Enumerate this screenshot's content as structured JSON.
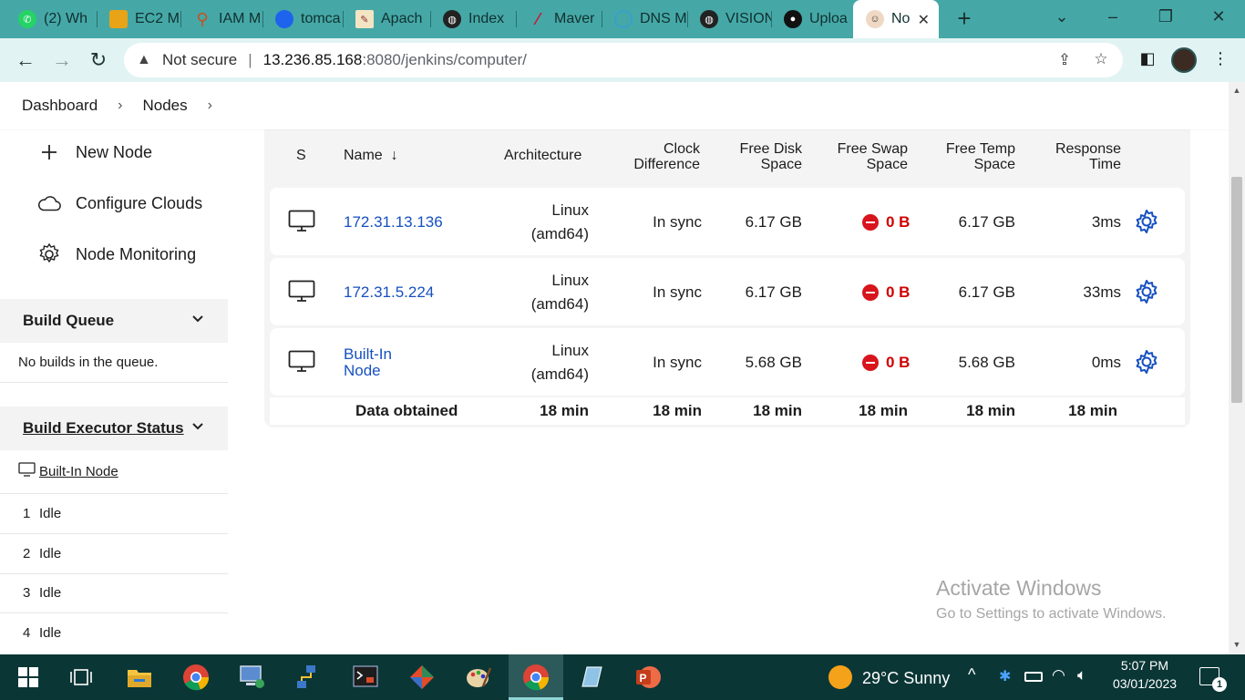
{
  "browser": {
    "tabs": [
      {
        "title": "(2) Wh",
        "icon": "whatsapp-icon",
        "color": "#25d366"
      },
      {
        "title": "EC2 M",
        "icon": "aws-ec2-icon",
        "color": "#e8a317"
      },
      {
        "title": "IAM M",
        "icon": "aws-iam-icon",
        "color": "#c7511f"
      },
      {
        "title": "tomca",
        "icon": "docker-icon",
        "color": "#1d63ed"
      },
      {
        "title": "Apach",
        "icon": "apache-icon",
        "color": "#8a2b2b"
      },
      {
        "title": "Index",
        "icon": "globe-icon",
        "color": "#222222"
      },
      {
        "title": "Maver",
        "icon": "maven-icon",
        "color": "#c71a36"
      },
      {
        "title": "DNS M",
        "icon": "dns-icon",
        "color": "#3aa0c8"
      },
      {
        "title": "VISION",
        "icon": "globe-icon",
        "color": "#222222"
      },
      {
        "title": "Uploa",
        "icon": "github-icon",
        "color": "#111111"
      },
      {
        "title": "No",
        "icon": "jenkins-icon",
        "color": "#d33833"
      }
    ],
    "url_host": "13.236.85.168",
    "url_rest": ":8080/jenkins/computer/",
    "security_label": "Not secure"
  },
  "breadcrumb": {
    "items": [
      "Dashboard",
      "Nodes"
    ]
  },
  "sidebar": {
    "tasks": [
      {
        "label": "New Node",
        "icon": "plus-icon"
      },
      {
        "label": "Configure Clouds",
        "icon": "cloud-icon"
      },
      {
        "label": "Node Monitoring",
        "icon": "gear-icon"
      }
    ],
    "build_queue": {
      "title": "Build Queue",
      "empty_text": "No builds in the queue."
    },
    "executor_status": {
      "title": "Build Executor Status",
      "node": "Built-In Node",
      "executors": [
        {
          "num": "1",
          "state": "Idle"
        },
        {
          "num": "2",
          "state": "Idle"
        },
        {
          "num": "3",
          "state": "Idle"
        },
        {
          "num": "4",
          "state": "Idle"
        }
      ]
    }
  },
  "table": {
    "headers": {
      "status": "S",
      "name": "Name",
      "sort_arrow": "↓",
      "architecture": "Architecture",
      "clock_1": "Clock",
      "clock_2": "Difference",
      "disk_1": "Free Disk",
      "disk_2": "Space",
      "swap_1": "Free Swap",
      "swap_2": "Space",
      "temp_1": "Free Temp",
      "temp_2": "Space",
      "resp_1": "Response",
      "resp_2": "Time"
    },
    "rows": [
      {
        "name_1": "172.31.13.136",
        "name_2": "",
        "arch_1": "Linux",
        "arch_2": "(amd64)",
        "clock": "In sync",
        "disk": "6.17 GB",
        "swap": "0 B",
        "temp": "6.17 GB",
        "resp": "3ms"
      },
      {
        "name_1": "172.31.5.224",
        "name_2": "",
        "arch_1": "Linux",
        "arch_2": "(amd64)",
        "clock": "In sync",
        "disk": "6.17 GB",
        "swap": "0 B",
        "temp": "6.17 GB",
        "resp": "33ms"
      },
      {
        "name_1": "Built-In",
        "name_2": "Node",
        "arch_1": "Linux",
        "arch_2": "(amd64)",
        "clock": "In sync",
        "disk": "5.68 GB",
        "swap": "0 B",
        "temp": "5.68 GB",
        "resp": "0ms"
      }
    ],
    "footer": {
      "label": "Data obtained",
      "values": [
        "18 min",
        "18 min",
        "18 min",
        "18 min",
        "18 min",
        "18 min"
      ]
    }
  },
  "watermark": {
    "line1": "Activate Windows",
    "line2": "Go to Settings to activate Windows."
  },
  "taskbar": {
    "weather": "29°C  Sunny",
    "time": "5:07 PM",
    "date": "03/01/2023",
    "notifications": "1"
  }
}
